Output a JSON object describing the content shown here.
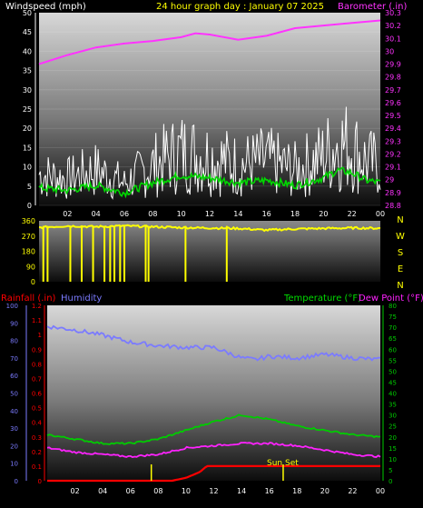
{
  "header": {
    "left_label": "Windspeed (mph)",
    "center_label": "24 hour graph day : January 07 2025",
    "right_label": "Barometer (.in)"
  },
  "wind_panel": {
    "left_ticks": [
      "0",
      "5",
      "10",
      "15",
      "20",
      "25",
      "30",
      "35",
      "40",
      "45",
      "50"
    ],
    "right_ticks": [
      "28.8",
      "28.9",
      "29",
      "29.1",
      "29.2",
      "29.3",
      "29.4",
      "29.5",
      "29.6",
      "29.7",
      "29.8",
      "29.9",
      "30",
      "30.1",
      "30.2",
      "30.3"
    ],
    "x_ticks": [
      "02",
      "04",
      "06",
      "08",
      "10",
      "12",
      "14",
      "16",
      "18",
      "20",
      "22",
      "00"
    ]
  },
  "dir_panel": {
    "left_ticks": [
      "0",
      "90",
      "180",
      "270",
      "360"
    ],
    "compass": [
      "N",
      "W",
      "S",
      "E",
      "N"
    ]
  },
  "lower_header": {
    "rainfall": "Rainfall (.in)",
    "humidity": "Humidity",
    "temperature": "Temperature (°F)",
    "dewpoint": "Dew Point (°F)"
  },
  "lower_panel": {
    "humidity_ticks": [
      "0",
      "10",
      "20",
      "30",
      "40",
      "50",
      "60",
      "70",
      "80",
      "90",
      "100"
    ],
    "rain_ticks": [
      "0",
      "0.1",
      "0.2",
      "0.3",
      "0.4",
      "0.5",
      "0.6",
      "0.7",
      "0.8",
      "0.9",
      "1",
      "1.1",
      "1.2"
    ],
    "temp_ticks": [
      "0",
      "5",
      "10",
      "15",
      "20",
      "25",
      "30",
      "35",
      "40",
      "45",
      "50",
      "55",
      "60",
      "65",
      "70",
      "75",
      "80"
    ],
    "x_ticks": [
      "02",
      "04",
      "06",
      "08",
      "10",
      "12",
      "14",
      "16",
      "18",
      "20",
      "22",
      "00"
    ],
    "annotation": "Sun Set"
  },
  "colors": {
    "windspeed": "#ffffff",
    "wind_avg": "#00d800",
    "barometer": "#ff33ff",
    "direction": "#ffff00",
    "humidity": "#7b7bff",
    "rainfall": "#ff0000",
    "temperature": "#00cc00",
    "dewpoint": "#ff22ff",
    "header_left": "#ffffff",
    "header_center": "#ffff00",
    "header_right": "#ff33ff"
  },
  "chart_data": [
    {
      "type": "line",
      "x_unit": "hour",
      "ylim_left": [
        0,
        50
      ],
      "ylim_right": [
        28.8,
        30.3
      ],
      "series": [
        {
          "name": "Windspeed",
          "axis": "left",
          "x": [
            0,
            2,
            4,
            6,
            8,
            10,
            12,
            14,
            16,
            18,
            20,
            21,
            22,
            23,
            24
          ],
          "values": [
            7,
            6,
            8,
            5,
            9,
            12,
            11,
            9,
            10,
            8,
            11,
            14,
            13,
            10,
            9
          ]
        },
        {
          "name": "Barometer",
          "axis": "right",
          "x": [
            0,
            2,
            4,
            6,
            8,
            10,
            11,
            12,
            14,
            16,
            18,
            20,
            22,
            24
          ],
          "values": [
            29.9,
            29.97,
            30.03,
            30.06,
            30.08,
            30.11,
            30.14,
            30.13,
            30.09,
            30.12,
            30.18,
            30.2,
            30.22,
            30.24
          ]
        }
      ]
    },
    {
      "type": "line",
      "x_unit": "hour",
      "ylim": [
        0,
        360
      ],
      "series": [
        {
          "name": "Wind direction",
          "x": [
            0,
            2,
            4,
            6,
            8,
            10,
            12,
            14,
            16,
            18,
            20,
            22,
            24
          ],
          "values": [
            320,
            330,
            325,
            330,
            325,
            320,
            318,
            315,
            305,
            312,
            315,
            318,
            316
          ]
        }
      ]
    },
    {
      "type": "line",
      "x_unit": "hour",
      "ylim_humidity": [
        0,
        100
      ],
      "ylim_rain": [
        0,
        1.2
      ],
      "ylim_temp": [
        0,
        80
      ],
      "series": [
        {
          "name": "Humidity",
          "axis": "humidity",
          "x": [
            0,
            2,
            4,
            6,
            8,
            10,
            12,
            14,
            15,
            16,
            18,
            20,
            22,
            24
          ],
          "values": [
            88,
            86,
            83,
            79,
            77,
            76,
            76,
            70,
            69,
            71,
            70,
            72,
            70,
            69
          ]
        },
        {
          "name": "Temperature",
          "axis": "temp",
          "x": [
            0,
            2,
            4,
            6,
            8,
            10,
            12,
            14,
            16,
            18,
            20,
            22,
            24
          ],
          "values": [
            21,
            19,
            17,
            17,
            19,
            23,
            27,
            30,
            28,
            25,
            23,
            21,
            20
          ]
        },
        {
          "name": "Dew Point",
          "axis": "temp",
          "x": [
            0,
            2,
            4,
            6,
            8,
            10,
            12,
            14,
            16,
            18,
            20,
            22,
            24
          ],
          "values": [
            15,
            13,
            12,
            11,
            12,
            15,
            16,
            17,
            17,
            16,
            14,
            12,
            11
          ]
        },
        {
          "name": "Rainfall",
          "axis": "rain",
          "x": [
            0,
            9,
            10,
            11,
            11.5,
            12,
            13,
            24
          ],
          "values": [
            0,
            0,
            0.02,
            0.06,
            0.1,
            0.1,
            0.1,
            0.1
          ]
        }
      ]
    }
  ]
}
